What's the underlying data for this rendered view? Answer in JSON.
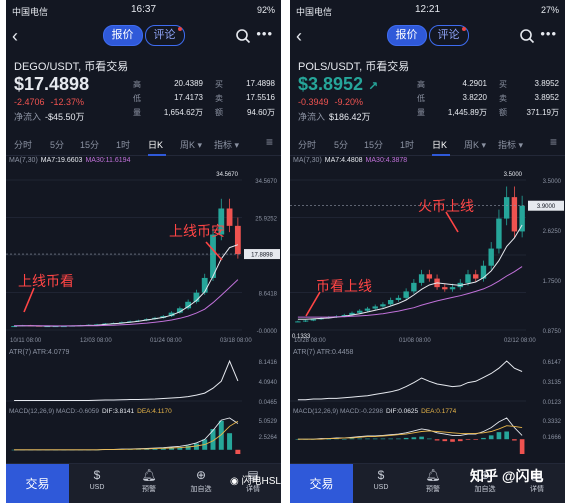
{
  "colors": {
    "background": "#131722",
    "accent": "#2f59d9",
    "up": "#26a69a",
    "down": "#ef5350",
    "ma7": "#e6e9ef",
    "ma30": "#c071d9",
    "dea": "#e7b549",
    "annotation": "#ff4545"
  },
  "screens": [
    {
      "status": {
        "carrier": "中国电信",
        "time": "16:37",
        "battery": "92%"
      },
      "tabs": {
        "quote": "报价",
        "comment": "评论"
      },
      "pair": "DEGO/USDT, 币看交易",
      "price": "$17.4898",
      "price_icon": "",
      "change_abs": "-2.4706",
      "change_pct": "-12.37%",
      "inflow_label": "净流入",
      "inflow_value": "-$45.50万",
      "stats": [
        {
          "k1": "高",
          "v1": "20.4389",
          "k2": "买",
          "v2": "17.4898"
        },
        {
          "k1": "低",
          "v1": "17.4173",
          "k2": "卖",
          "v2": "17.5516"
        },
        {
          "k1": "量",
          "v1": "1,654.62万",
          "k2": "额",
          "v2": "94.60万"
        }
      ],
      "timeframes": [
        "分时",
        "5分",
        "15分",
        "1时",
        "日K",
        "周K ▾",
        "指标 ▾"
      ],
      "selected_timeframe": 4,
      "ma_label": "MA(7,30)",
      "ma7": "MA7:19.6603",
      "ma30": "MA30:11.6194",
      "atr_label": "ATR(7)",
      "atr_value": "ATR:4.0779",
      "macd_label": "MACD(12,26,9)",
      "macd_value": "MACD:-0.6059",
      "dif_value": "DIF:3.8141",
      "dea_value": "DEA:4.1170",
      "annotations": [
        "上线币看",
        "上线币安"
      ],
      "watermark": "闪电HSL",
      "nav": {
        "trade": "交易",
        "items": [
          "USD",
          "预警",
          "加自选",
          "详情"
        ]
      },
      "chart_data": {
        "type": "candlestick",
        "title": "",
        "x_ticks": [
          "10/11 08:00",
          "12/03 08:00",
          "01/24 08:00",
          "03/18 08:00"
        ],
        "y_ticks": [
          "34.5670",
          "25.9252",
          "17.2834",
          "8.6418",
          "-0.0000"
        ],
        "ylim": [
          0,
          34.567
        ],
        "last_price_tag": "17.8898",
        "high_label": "34.5670",
        "close": [
          0.9,
          1.1,
          1.0,
          0.9,
          0.9,
          0.9,
          0.9,
          1.0,
          1.1,
          1.2,
          1.3,
          1.5,
          1.6,
          1.8,
          2.0,
          2.2,
          2.5,
          2.8,
          3.2,
          4.0,
          5.0,
          6.5,
          8.6,
          12.0,
          22.0,
          28.0,
          24.0,
          17.5
        ],
        "ma7": [
          0.95,
          1.0,
          1.0,
          0.95,
          0.9,
          0.9,
          0.92,
          0.95,
          1.0,
          1.05,
          1.1,
          1.3,
          1.45,
          1.6,
          1.8,
          2.0,
          2.3,
          2.6,
          2.9,
          3.4,
          4.2,
          5.4,
          6.8,
          8.8,
          12.4,
          16.4,
          19.0,
          19.66
        ],
        "ma30": [
          1.0,
          1.0,
          1.0,
          0.98,
          0.96,
          0.95,
          0.95,
          0.95,
          0.96,
          0.98,
          1.0,
          1.05,
          1.1,
          1.2,
          1.3,
          1.45,
          1.6,
          1.8,
          2.0,
          2.3,
          2.7,
          3.2,
          3.9,
          4.8,
          6.3,
          8.0,
          9.8,
          11.62
        ],
        "atr": {
          "y_ticks": [
            "8.1416",
            "4.0940",
            "0.0465"
          ],
          "values": [
            0.1,
            0.1,
            0.1,
            0.1,
            0.1,
            0.1,
            0.1,
            0.1,
            0.1,
            0.1,
            0.15,
            0.2,
            0.2,
            0.25,
            0.3,
            0.3,
            0.35,
            0.4,
            0.5,
            0.6,
            0.7,
            0.9,
            1.2,
            1.6,
            2.6,
            4.0,
            8.1,
            4.08
          ]
        },
        "macd": {
          "y_ticks": [
            "5.0529",
            "2.5264"
          ],
          "dif": [
            0,
            0,
            0,
            0,
            0,
            0,
            0,
            0,
            0,
            0,
            0,
            0.05,
            0.05,
            0.1,
            0.1,
            0.15,
            0.2,
            0.25,
            0.3,
            0.4,
            0.5,
            0.7,
            1.0,
            1.5,
            2.8,
            4.3,
            4.6,
            3.81
          ],
          "dea": [
            0,
            0,
            0,
            0,
            0,
            0,
            0,
            0,
            0,
            0,
            0,
            0.02,
            0.03,
            0.05,
            0.07,
            0.1,
            0.13,
            0.17,
            0.21,
            0.26,
            0.32,
            0.4,
            0.55,
            0.75,
            1.3,
            2.2,
            3.4,
            4.12
          ],
          "hist": [
            0,
            0,
            0,
            0,
            0,
            0,
            0,
            0,
            0,
            0,
            0,
            0.06,
            0.04,
            0.1,
            0.06,
            0.1,
            0.14,
            0.16,
            0.18,
            0.28,
            0.36,
            0.6,
            0.9,
            1.5,
            3.0,
            4.2,
            2.4,
            -0.61
          ]
        }
      }
    },
    {
      "status": {
        "carrier": "中国电信",
        "time": "12:21",
        "battery": "27%"
      },
      "tabs": {
        "quote": "报价",
        "comment": "评论"
      },
      "pair": "POLS/USDT, 币看交易",
      "price": "$3.8952",
      "price_icon": "↗",
      "change_abs": "-0.3949",
      "change_pct": "-9.20%",
      "inflow_label": "净流入",
      "inflow_value": "$186.42万",
      "stats": [
        {
          "k1": "高",
          "v1": "4.2901",
          "k2": "买",
          "v2": "3.8952"
        },
        {
          "k1": "低",
          "v1": "3.8220",
          "k2": "卖",
          "v2": "3.8952"
        },
        {
          "k1": "量",
          "v1": "1,445.89万",
          "k2": "额",
          "v2": "371.19万"
        }
      ],
      "timeframes": [
        "分时",
        "5分",
        "15分",
        "1时",
        "日K",
        "周K ▾",
        "指标 ▾"
      ],
      "selected_timeframe": 4,
      "ma_label": "MA(7,30)",
      "ma7": "MA7:4.4808",
      "ma30": "MA30:4.3878",
      "atr_label": "ATR(7)",
      "atr_value": "ATR:0.4458",
      "macd_label": "MACD(12,26,9)",
      "macd_value": "MACD:-0.2298",
      "dif_value": "DIF:0.0625",
      "dea_value": "DEA:0.1774",
      "annotations": [
        "币看上线",
        "火币上线"
      ],
      "watermark": "知乎 @闪电",
      "nav": {
        "trade": "交易",
        "items": [
          "USD",
          "预警",
          "加自选",
          "详情"
        ]
      },
      "chart_data": {
        "type": "candlestick",
        "title": "",
        "x_ticks": [
          "10/28 08:00",
          "01/08 08:00",
          "02/12 08:00"
        ],
        "y_ticks": [
          "3.5000",
          "2.6250",
          "1.7500",
          "0.8750"
        ],
        "ylim": [
          0,
          3.5
        ],
        "last_price_tag": "3.9000",
        "high_label": "3.5000",
        "low_label": "0.1333",
        "close": [
          0.2,
          0.22,
          0.25,
          0.28,
          0.3,
          0.32,
          0.35,
          0.4,
          0.45,
          0.5,
          0.55,
          0.6,
          0.7,
          0.75,
          0.9,
          1.1,
          1.3,
          1.2,
          1.0,
          0.95,
          1.0,
          1.1,
          1.3,
          1.2,
          1.5,
          1.9,
          2.6,
          3.1,
          2.3,
          2.9
        ],
        "ma7": [
          0.25,
          0.25,
          0.26,
          0.27,
          0.28,
          0.3,
          0.32,
          0.35,
          0.38,
          0.42,
          0.46,
          0.5,
          0.56,
          0.62,
          0.7,
          0.82,
          0.95,
          1.05,
          1.1,
          1.08,
          1.06,
          1.04,
          1.08,
          1.12,
          1.22,
          1.38,
          1.62,
          1.95,
          2.15,
          2.45
        ],
        "ma30": [
          0.3,
          0.3,
          0.3,
          0.3,
          0.3,
          0.31,
          0.31,
          0.32,
          0.33,
          0.34,
          0.36,
          0.38,
          0.41,
          0.44,
          0.48,
          0.52,
          0.58,
          0.63,
          0.68,
          0.72,
          0.76,
          0.8,
          0.85,
          0.9,
          0.96,
          1.04,
          1.14,
          1.26,
          1.36,
          1.48
        ],
        "atr": {
          "y_ticks": [
            "0.6147",
            "0.3135",
            "0.0123"
          ],
          "values": [
            0.02,
            0.02,
            0.03,
            0.03,
            0.04,
            0.04,
            0.05,
            0.06,
            0.07,
            0.08,
            0.1,
            0.12,
            0.14,
            0.17,
            0.22,
            0.28,
            0.35,
            0.3,
            0.26,
            0.24,
            0.22,
            0.23,
            0.28,
            0.3,
            0.36,
            0.42,
            0.5,
            0.61,
            0.5,
            0.45
          ]
        },
        "macd": {
          "y_ticks": [
            "0.3332",
            "0.1666"
          ],
          "dif": [
            0,
            0,
            0,
            0.01,
            0.01,
            0.02,
            0.02,
            0.03,
            0.04,
            0.05,
            0.05,
            0.06,
            0.07,
            0.08,
            0.1,
            0.13,
            0.16,
            0.14,
            0.1,
            0.08,
            0.06,
            0.06,
            0.08,
            0.08,
            0.12,
            0.18,
            0.27,
            0.33,
            0.18,
            0.06
          ],
          "dea": [
            0,
            0,
            0,
            0,
            0.01,
            0.01,
            0.02,
            0.02,
            0.03,
            0.04,
            0.04,
            0.05,
            0.06,
            0.07,
            0.08,
            0.1,
            0.12,
            0.13,
            0.12,
            0.11,
            0.1,
            0.09,
            0.09,
            0.09,
            0.1,
            0.12,
            0.16,
            0.21,
            0.2,
            0.18
          ],
          "hist": [
            0,
            0,
            0,
            0.01,
            0,
            0.01,
            0,
            0.01,
            0.01,
            0.01,
            0.01,
            0.01,
            0.01,
            0.01,
            0.02,
            0.03,
            0.04,
            0.01,
            -0.02,
            -0.03,
            -0.04,
            -0.03,
            -0.01,
            -0.01,
            0.02,
            0.06,
            0.11,
            0.12,
            -0.02,
            -0.23
          ]
        }
      }
    }
  ]
}
